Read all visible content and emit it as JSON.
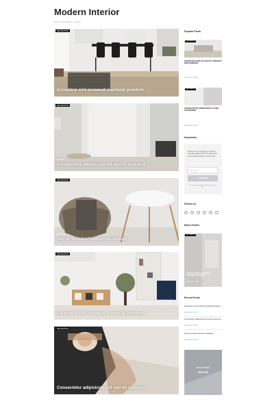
{
  "page": {
    "title": "Modern Interior"
  },
  "breadcrumb": {
    "home": "Home",
    "section": "Decoration",
    "current": "Interior",
    "sep": ">"
  },
  "posts": [
    {
      "category": "DECORATION",
      "title": "Excepteur sint occaecat cupidatat proident",
      "meta": ""
    },
    {
      "category": "DECORATION",
      "title": "Consectetur adipisicing elit sed do eiusmod",
      "meta": "BY ADMIN"
    },
    {
      "category": "DECORATION",
      "title": "Sed do eiusmod tempor incididunt",
      "meta": "BY ADMIN"
    },
    {
      "category": "DECORATION",
      "title": "Excepteur sint occaecat cupidatat proident",
      "meta": ""
    },
    {
      "category": "DECORATION",
      "title": "Consectetur adipisicing elit sed do eiusmod",
      "meta": ""
    }
  ],
  "sidebar": {
    "popular": {
      "heading": "Popular Posts",
      "items": [
        {
          "category": "DECORATION",
          "title": "EXCEPTEUR SINT OCCAECAT CUPIDATAT NON PROIDENT",
          "date": "November 5, 2021"
        },
        {
          "category": "DECORATION",
          "title": "CONSECTETUR ADIPISICING ELIT SED DO EIUSMOD",
          "date": "November 5, 2021"
        }
      ]
    },
    "newsletter": {
      "heading": "Newsletter",
      "text": "Subscribe to our mailing list newsletter and stay updated with all our latest posts about amazing designs in your interior.",
      "placeholder": "Your email...",
      "button": "SUBSCRIBE",
      "note": "We will never spam you. Unsubscribe at any time."
    },
    "follow": {
      "heading": "Follow Us"
    },
    "most_viewed": {
      "heading": "Most Viewed",
      "category": "DECORATION",
      "title": "SED DO EIUSMOD INCIDIDUNT CUPIDATAT PROIDENT",
      "date": "November 5, 2021"
    },
    "recent": {
      "heading": "Recent Posts",
      "items": [
        {
          "title": "Excepteur sint occaecat cupidatat proident",
          "date": "November 5, 2021"
        },
        {
          "title": "Consectetur adipisicing elit sed do eiusmod",
          "date": "November 5, 2021"
        },
        {
          "title": "Sed do eiusmod tempor incididunt",
          "date": "November 5, 2021"
        }
      ]
    },
    "ad": {
      "label": "ADVERTISEMENT",
      "size": "260x260"
    }
  }
}
